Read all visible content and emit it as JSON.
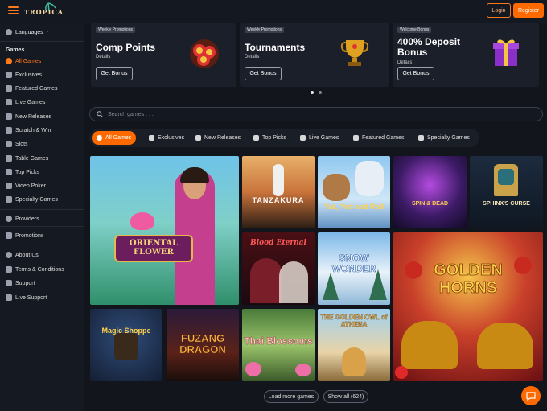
{
  "header": {
    "logo_text": "TROPICA",
    "login_label": "Login",
    "register_label": "Register"
  },
  "sidebar": {
    "languages_label": "Languages",
    "games_heading": "Games",
    "game_items": [
      {
        "label": "All Games",
        "icon": "horseshoe-icon"
      },
      {
        "label": "Exclusives",
        "icon": "star-icon"
      },
      {
        "label": "Featured Games",
        "icon": "flame-icon"
      },
      {
        "label": "Live Games",
        "icon": "live-icon"
      },
      {
        "label": "New Releases",
        "icon": "new-icon"
      },
      {
        "label": "Scratch & Win",
        "icon": "scratch-icon"
      },
      {
        "label": "Slots",
        "icon": "slots-icon"
      },
      {
        "label": "Table Games",
        "icon": "table-icon"
      },
      {
        "label": "Top Picks",
        "icon": "trophy-icon"
      },
      {
        "label": "Video Poker",
        "icon": "cards-icon"
      },
      {
        "label": "Specialty Games",
        "icon": "dice-icon"
      }
    ],
    "providers_label": "Providers",
    "promotions_label": "Promotions",
    "footer_items": [
      {
        "label": "About Us"
      },
      {
        "label": "Terms & Conditions"
      },
      {
        "label": "Support"
      },
      {
        "label": "Live Support"
      }
    ]
  },
  "promos": [
    {
      "tag": "Weekly Promotions",
      "title": "Comp Points",
      "details": "Details",
      "button": "Get Bonus",
      "icon": "coins-icon"
    },
    {
      "tag": "Weekly Promotions",
      "title": "Tournaments",
      "details": "Details",
      "button": "Get Bonus",
      "icon": "trophy-cup-icon"
    },
    {
      "tag": "Welcome Bonus",
      "title": "400% Deposit Bonus",
      "details": "Details",
      "button": "Get Bonus",
      "icon": "gift-box-icon"
    }
  ],
  "search": {
    "placeholder": "Search games . . ."
  },
  "tabs": [
    {
      "label": "All Games"
    },
    {
      "label": "Exclusives"
    },
    {
      "label": "New Releases"
    },
    {
      "label": "Top Picks"
    },
    {
      "label": "Live Games"
    },
    {
      "label": "Featured Games"
    },
    {
      "label": "Specialty Games"
    }
  ],
  "games": [
    {
      "title": "ORIENTAL FLOWER"
    },
    {
      "title": "TANZAKURA"
    },
    {
      "title": "Yak, Yeti and Roll"
    },
    {
      "title": "SPIN & DEAD"
    },
    {
      "title": "SPHINX'S CURSE"
    },
    {
      "title": "Blood Eternal"
    },
    {
      "title": "SNOW WONDER"
    },
    {
      "title": "GOLDEN HORNS"
    },
    {
      "title": "Magic Shoppe"
    },
    {
      "title": "FUZANG DRAGON"
    },
    {
      "title": "Thai Blossoms"
    },
    {
      "title": "THE GOLDEN OWL of ATHENA"
    }
  ],
  "pagination": {
    "load_more": "Load more games",
    "show_all": "Show all (624)"
  },
  "colors": {
    "accent": "#ff6a00",
    "bg": "#12151c",
    "card": "#1b1f29"
  }
}
